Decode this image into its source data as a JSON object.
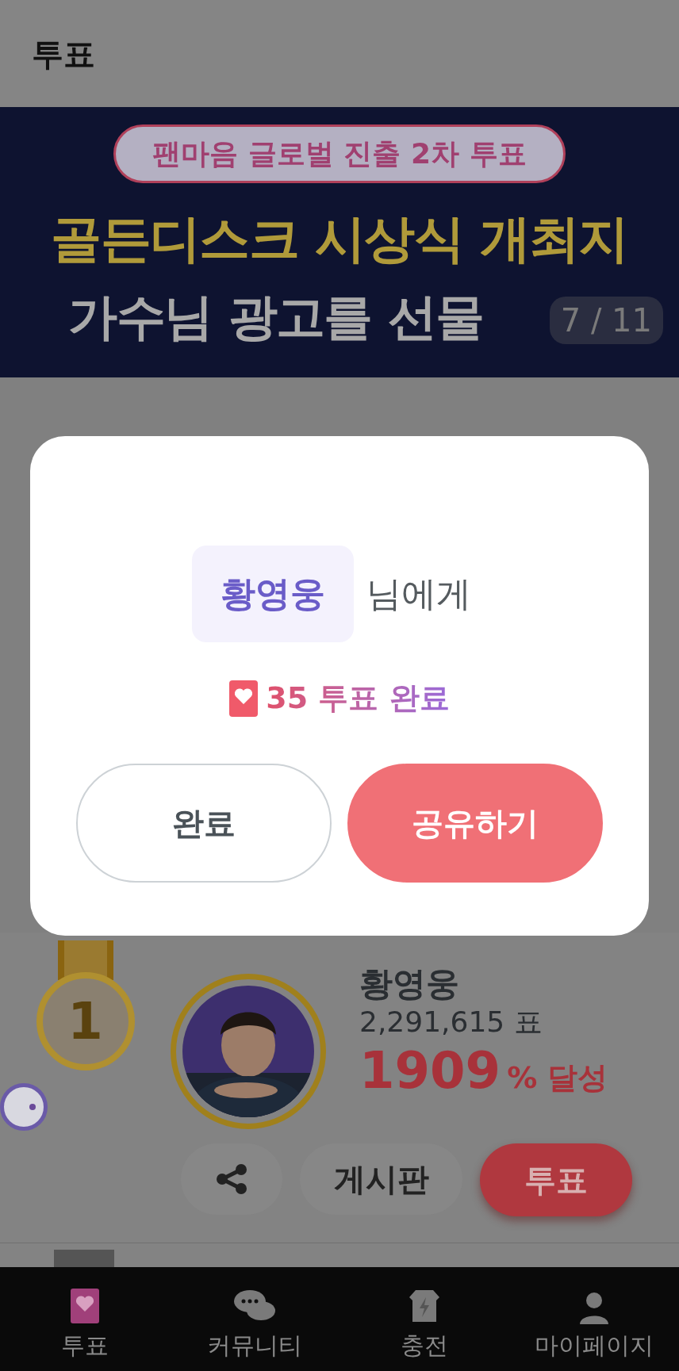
{
  "header": {
    "title": "투표"
  },
  "banner": {
    "badge": "팬마음 글로벌 진출 2차 투표",
    "line_1": "골든디스크 시상식 개최지",
    "line_2": "가수님 광고를 선물",
    "counter": "7 / 11"
  },
  "dialog": {
    "recipient": "황영웅",
    "recipient_suffix": "님에게",
    "result": "35 투표 완료",
    "buttons": [
      {
        "label": "완료",
        "kind": "secondary"
      },
      {
        "label": "공유하기",
        "kind": "primary"
      }
    ]
  },
  "ranking": [
    {
      "rank": "1",
      "name": "황영웅",
      "votes": "2,291,615 표",
      "percent": "1909",
      "percent_suffix": "% 달성",
      "actions": [
        {
          "kind": "share"
        },
        {
          "kind": "board",
          "label": "게시판"
        },
        {
          "kind": "vote",
          "label": "투표"
        }
      ]
    }
  ],
  "nav": [
    {
      "label": "투표",
      "kind": "vote",
      "selected": true
    },
    {
      "label": "커뮤니티",
      "kind": "community",
      "selected": false
    },
    {
      "label": "충전",
      "kind": "charge",
      "selected": false
    },
    {
      "label": "마이페이지",
      "kind": "mypage",
      "selected": false
    }
  ]
}
